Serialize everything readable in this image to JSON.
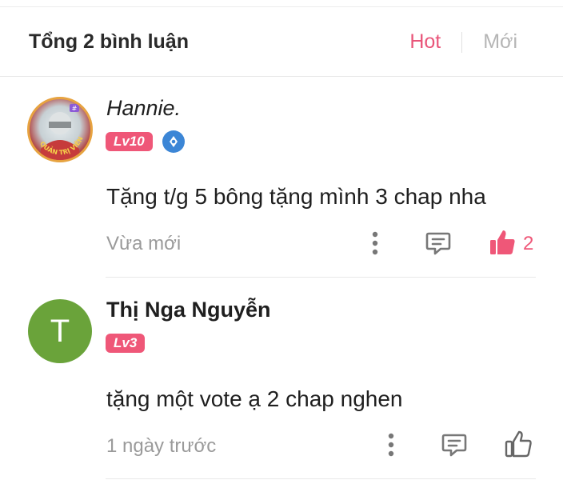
{
  "header": {
    "total_label": "Tổng 2 bình luận",
    "sort_hot": "Hot",
    "sort_new": "Mới",
    "active_color": "#e9567a"
  },
  "comments": [
    {
      "username": "Hannie.",
      "level": "Lv10",
      "avatar_frame_text": "QUẢN TRỊ VIÊN",
      "verified_icon": "vip-badge-icon",
      "text": "Tặng t/g 5 bông tặng mình 3 chap nha",
      "time": "Vừa mới",
      "likes": "2",
      "liked": true
    },
    {
      "username": "Thị Nga Nguyễn",
      "avatar_letter": "T",
      "level": "Lv3",
      "text": "tặng một vote ạ 2 chap nghen",
      "time": "1 ngày trước",
      "liked": false
    }
  ]
}
